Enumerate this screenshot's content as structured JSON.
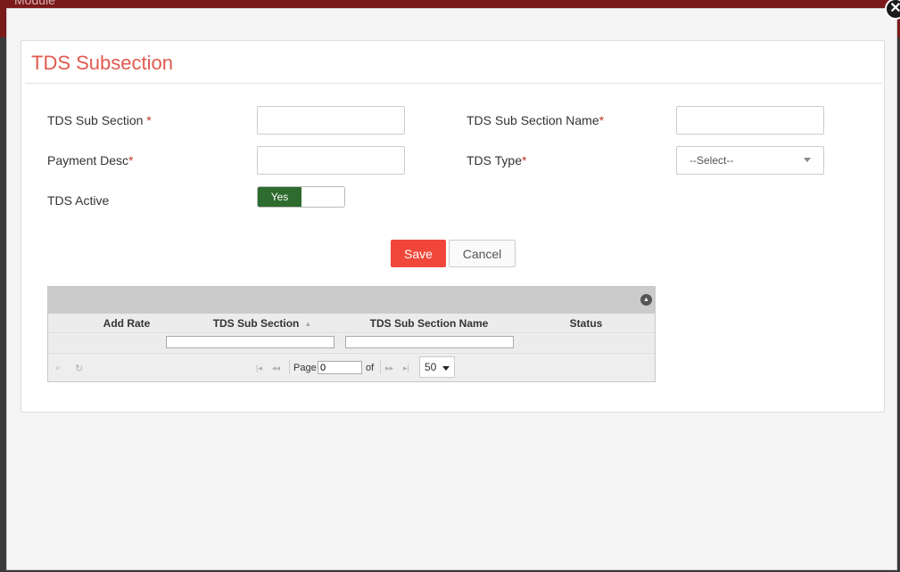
{
  "background": {
    "header_text": "Module"
  },
  "modal": {
    "close_icon": "✕",
    "title": "TDS Subsection",
    "form": {
      "tds_sub_section": {
        "label": "TDS Sub Section ",
        "required_mark": "*",
        "value": ""
      },
      "tds_sub_section_name": {
        "label": "TDS Sub Section Name",
        "required_mark": "*",
        "value": ""
      },
      "payment_desc": {
        "label": "Payment Desc",
        "required_mark": "*",
        "value": ""
      },
      "tds_type": {
        "label": "TDS Type",
        "required_mark": "*",
        "selected": "--Select--"
      },
      "tds_active": {
        "label": "TDS Active",
        "toggle_label": "Yes",
        "state": "on"
      }
    },
    "buttons": {
      "save": "Save",
      "cancel": "Cancel"
    },
    "grid": {
      "columns": [
        "Add Rate",
        "TDS Sub Section",
        "TDS Sub Section Name",
        "Status"
      ],
      "sorted_column": "TDS Sub Section",
      "pager": {
        "page_label": "Page",
        "page_value": "0",
        "of_label": "of",
        "page_size": "50"
      }
    }
  },
  "colors": {
    "accent": "#e05a4f",
    "save": "#f0473a",
    "toggle_on": "#2e6b2e",
    "topbar": "#7b1a1a"
  },
  "icons": {
    "close": "close-icon",
    "collapse": "collapse-icon",
    "search": "search-icon",
    "refresh": "refresh-icon",
    "first": "first-page-icon",
    "prev": "prev-page-icon",
    "next": "next-page-icon",
    "last": "last-page-icon",
    "sort": "sort-icon",
    "dropdown": "chevron-down-icon"
  }
}
